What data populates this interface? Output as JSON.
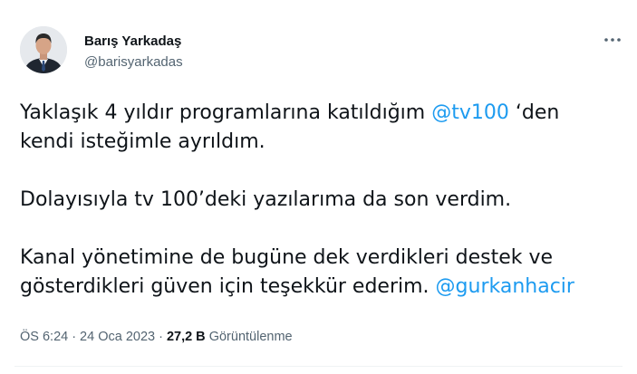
{
  "author": {
    "display_name": "Barış Yarkadaş",
    "handle": "@barisyarkadas"
  },
  "icons": {
    "more": "more-dots-icon",
    "avatar": "profile-photo"
  },
  "tweet": {
    "line1_pre": "Yaklaşık 4 yıldır programlarına katıldığım ",
    "mention1": "@tv100",
    "line1_post": " ‘den",
    "line2": "kendi isteğimle ayrıldım.",
    "line3": "Dolayısıyla tv 100’deki yazılarıma da son verdim.",
    "line4": "Kanal yönetimine de bugüne dek verdikleri destek ve",
    "line5_pre": "gösterdikleri güven için teşekkür ederim. ",
    "mention2": "@gurkanhacir"
  },
  "meta": {
    "time": "ÖS 6:24",
    "separator": "·",
    "date": "24 Oca 2023",
    "views_count": "27,2 B",
    "views_label": "Görüntülenme"
  },
  "colors": {
    "link": "#1d9bf0",
    "text": "#0f1419",
    "secondary": "#536471",
    "divider": "#eff3f4"
  }
}
